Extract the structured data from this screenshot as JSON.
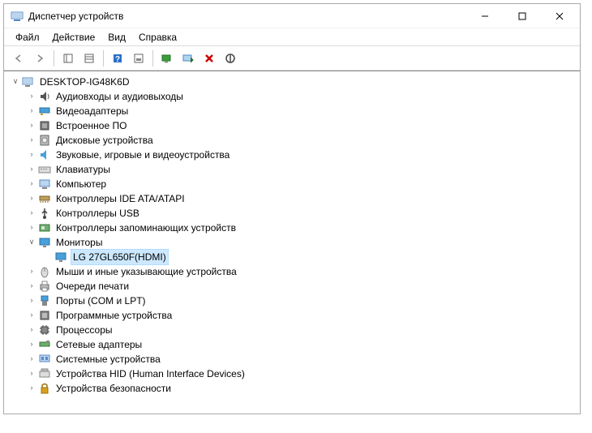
{
  "window": {
    "title": "Диспетчер устройств"
  },
  "menu": {
    "file": "Файл",
    "action": "Действие",
    "view": "Вид",
    "help": "Справка"
  },
  "tree": {
    "root": "DESKTOP-IG48K6D",
    "items": [
      {
        "label": "Аудиовходы и аудиовыходы",
        "icon": "audio-icon"
      },
      {
        "label": "Видеоадаптеры",
        "icon": "display-adapter-icon"
      },
      {
        "label": "Встроенное ПО",
        "icon": "firmware-icon"
      },
      {
        "label": "Дисковые устройства",
        "icon": "disk-icon"
      },
      {
        "label": "Звуковые, игровые и видеоустройства",
        "icon": "sound-icon"
      },
      {
        "label": "Клавиатуры",
        "icon": "keyboard-icon"
      },
      {
        "label": "Компьютер",
        "icon": "computer-icon"
      },
      {
        "label": "Контроллеры IDE ATA/ATAPI",
        "icon": "ide-icon"
      },
      {
        "label": "Контроллеры USB",
        "icon": "usb-icon"
      },
      {
        "label": "Контроллеры запоминающих устройств",
        "icon": "storage-controller-icon"
      },
      {
        "label": "Мониторы",
        "icon": "monitor-icon",
        "expanded": true,
        "children": [
          {
            "label": "LG 27GL650F(HDMI)",
            "icon": "monitor-icon",
            "selected": true
          }
        ]
      },
      {
        "label": "Мыши и иные указывающие устройства",
        "icon": "mouse-icon"
      },
      {
        "label": "Очереди печати",
        "icon": "printer-icon"
      },
      {
        "label": "Порты (COM и LPT)",
        "icon": "port-icon"
      },
      {
        "label": "Программные устройства",
        "icon": "software-device-icon"
      },
      {
        "label": "Процессоры",
        "icon": "cpu-icon"
      },
      {
        "label": "Сетевые адаптеры",
        "icon": "network-icon"
      },
      {
        "label": "Системные устройства",
        "icon": "system-device-icon"
      },
      {
        "label": "Устройства HID (Human Interface Devices)",
        "icon": "hid-icon"
      },
      {
        "label": "Устройства безопасности",
        "icon": "security-device-icon"
      }
    ]
  }
}
